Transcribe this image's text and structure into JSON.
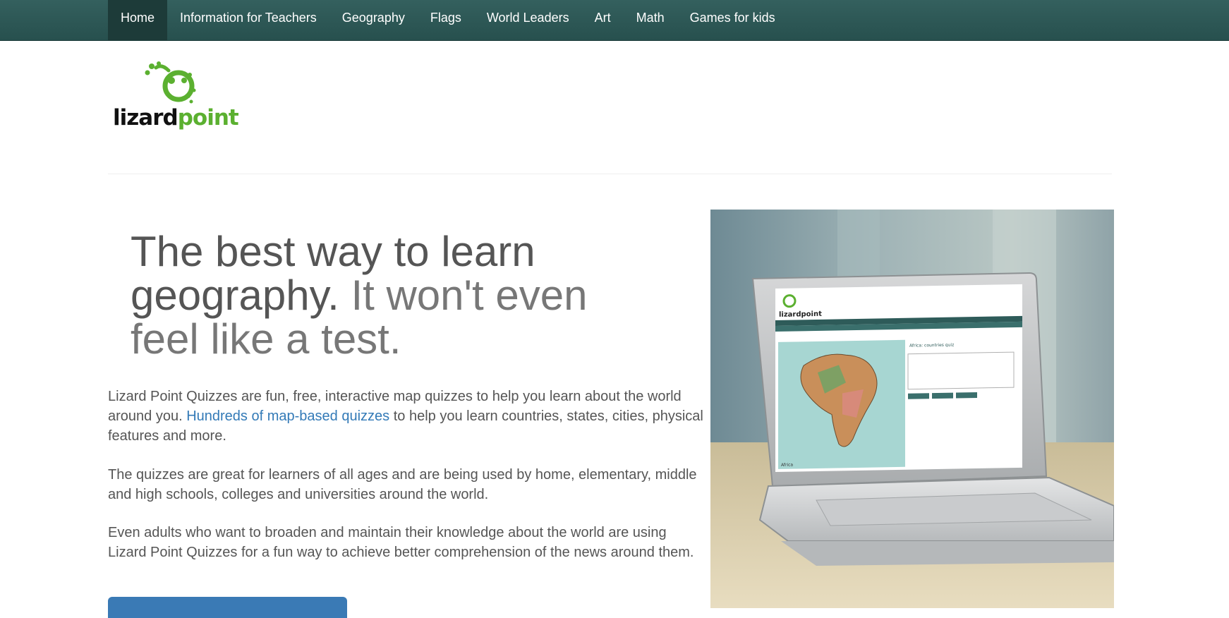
{
  "nav": {
    "items": [
      {
        "label": "Home",
        "active": true
      },
      {
        "label": "Information for Teachers"
      },
      {
        "label": "Geography"
      },
      {
        "label": "Flags"
      },
      {
        "label": "World Leaders"
      },
      {
        "label": "Art"
      },
      {
        "label": "Math"
      },
      {
        "label": "Games for kids"
      }
    ]
  },
  "logo": {
    "part1": "lizard",
    "part2": "point",
    "icon": "lizard-icon"
  },
  "hero": {
    "title_main": "The best way to learn geography.",
    "title_light": "It won't even feel like a test."
  },
  "intro": {
    "p1_before": "Lizard Point Quizzes are fun, free, interactive map quizzes to help you learn about the world around you.",
    "p1_link": "Hundreds of map-based quizzes",
    "p1_after": "to help you learn countries, states, cities, physical features and more.",
    "p2": "The quizzes are great for learners of all ages and are being used by home, elementary, middle and high schools, colleges and universities around the world.",
    "p3": "Even adults who want to broaden and maintain their knowledge about the world are using Lizard Point Quizzes for a fun way to achieve better comprehension of the news around them."
  },
  "colors": {
    "nav_bg": "#2e5b59",
    "link": "#337ab7",
    "brand_green": "#5bb030",
    "cta": "#3a7ab5"
  },
  "screen": {
    "logo_text": "lizardpoint",
    "quiz_title": "Africa: countries quiz",
    "map_label": "Africa"
  }
}
